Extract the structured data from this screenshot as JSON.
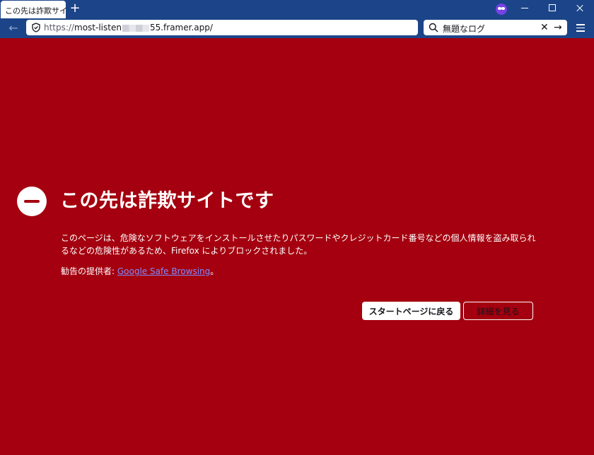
{
  "browser": {
    "tab_title": "この先は詐欺サイト",
    "new_tab_label": "+",
    "url_prefix": "https://",
    "url_host_start": "most-listen",
    "url_host_end": "55.framer.app/",
    "search_text": "無題なログ",
    "back_glyph": "←",
    "clear_glyph": "✕",
    "go_glyph": "→"
  },
  "page": {
    "title": "この先は詐欺サイトです",
    "description": "このページは、危険なソフトウェアをインストールさせたりパスワードやクレジットカード番号などの個人情報を盗み取られるなどの危険性があるため、Firefox によりブロックされました。",
    "source_prefix": "勧告の提供者: ",
    "source_link": "Google Safe Browsing",
    "source_suffix": "。",
    "primary_button": "スタートページに戻る",
    "secondary_button": "詳細を見る"
  },
  "colors": {
    "page_background": "#a4000f",
    "toolbar": "#1c4589",
    "link": "#7d8cff"
  },
  "icons": [
    "shield-icon",
    "search-icon",
    "hamburger-menu-icon",
    "blocked-icon",
    "extension-icon"
  ]
}
